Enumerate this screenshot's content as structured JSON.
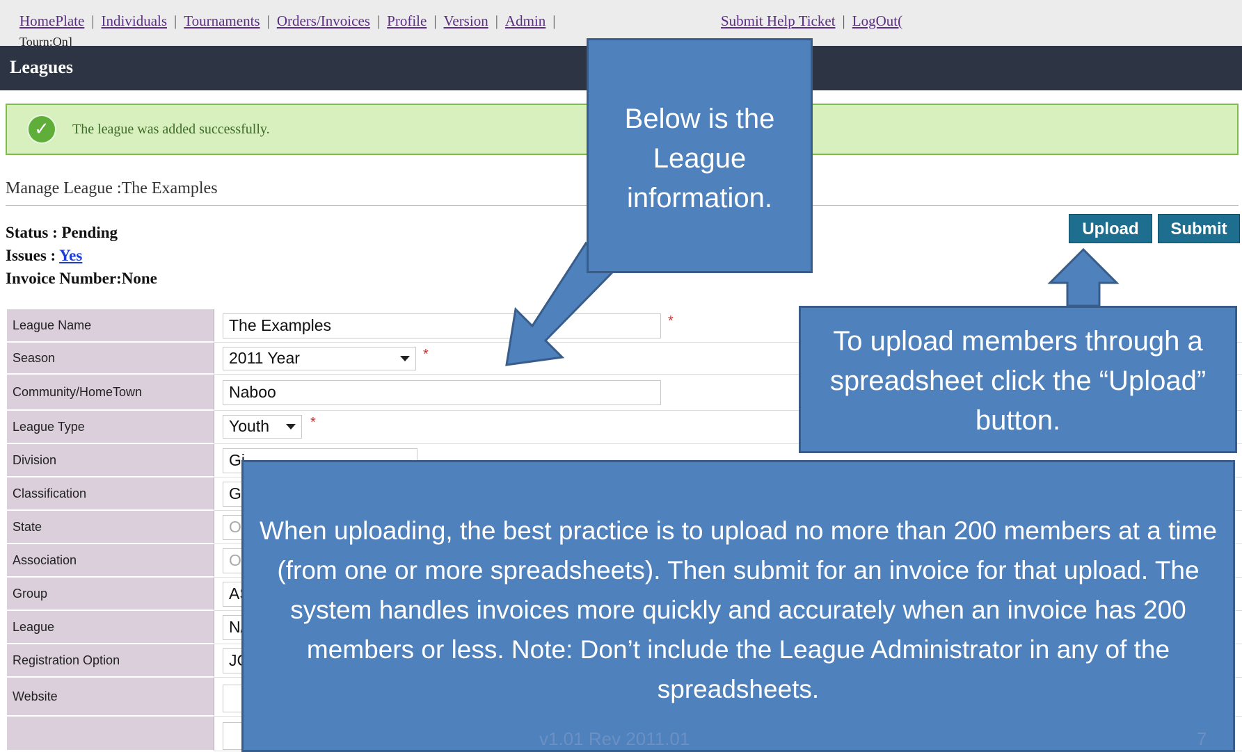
{
  "nav": {
    "links": [
      "HomePlate",
      "Individuals",
      "Tournaments",
      "Orders/Invoices",
      "Profile",
      "Version",
      "Admin"
    ],
    "help": "Submit Help Ticket",
    "logout": "LogOut(",
    "town": "Tourn:On]"
  },
  "header": {
    "title": "Leagues"
  },
  "success": {
    "message": "The league was added successfully."
  },
  "manage": {
    "title": "Manage League :The Examples"
  },
  "status": {
    "status_label": "Status : Pending",
    "issues_label": "Issues : ",
    "issues_link": "Yes",
    "invoice": "Invoice Number:None"
  },
  "buttons": {
    "upload": "Upload",
    "submit": "Submit"
  },
  "form": {
    "labels": [
      "League Name",
      "Season",
      "Community/HomeTown",
      "League Type",
      "Division",
      "Classification",
      "State",
      "Association",
      "Group",
      "League",
      "Registration Option",
      "Website",
      ""
    ],
    "league_name": "The Examples",
    "season": "2011 Year",
    "community": "Naboo",
    "league_type": "Youth",
    "division_partial": "Gi",
    "classification_partial": "Gi",
    "state_partial": "Ol",
    "association_partial": "Ol",
    "group_partial": "AS",
    "league_partial": "N/",
    "registration_partial": "JC"
  },
  "callouts": {
    "league_info": "Below is the League information.",
    "upload_info": "To upload members through a spreadsheet click the “Upload” button.",
    "best_practice": "When uploading, the best practice is to upload no more than 200 members at a time (from one or more spreadsheets). Then submit for an invoice for that upload. The system handles invoices more quickly and  accurately when an invoice has 200 members or less. Note: Don’t include the League Administrator in any of the spreadsheets."
  },
  "footer": {
    "version": "v1.01 Rev 2011.01",
    "page": "7"
  },
  "colors": {
    "callout": "#4f81bd",
    "header": "#2d3544",
    "label_bg": "#dccfdc",
    "button": "#1e6f8f"
  }
}
